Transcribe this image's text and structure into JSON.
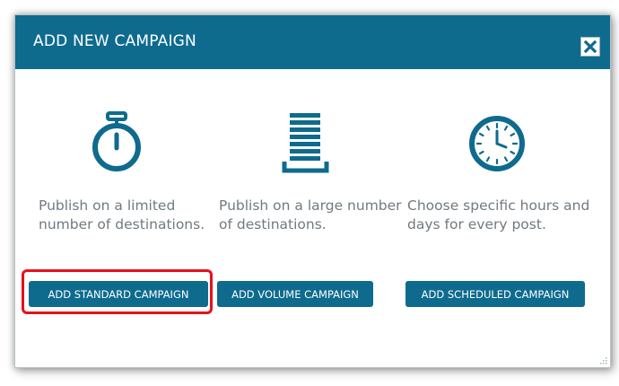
{
  "dialog": {
    "title": "ADD NEW CAMPAIGN",
    "close_icon": "close-icon"
  },
  "options": [
    {
      "icon": "stopwatch-icon",
      "description": "Publish on a limited number of destinations.",
      "button_label": "ADD STANDARD CAMPAIGN"
    },
    {
      "icon": "volume-stack-icon",
      "description": "Publish on a large number of destinations.",
      "button_label": "ADD VOLUME CAMPAIGN"
    },
    {
      "icon": "clock-icon",
      "description": "Choose specific hours and days for every post.",
      "button_label": "ADD SCHEDULED CAMPAIGN"
    }
  ],
  "colors": {
    "header": "#0e6b8e",
    "button": "#0e6b8e",
    "text": "#717a80",
    "highlight": "#e8101a"
  }
}
